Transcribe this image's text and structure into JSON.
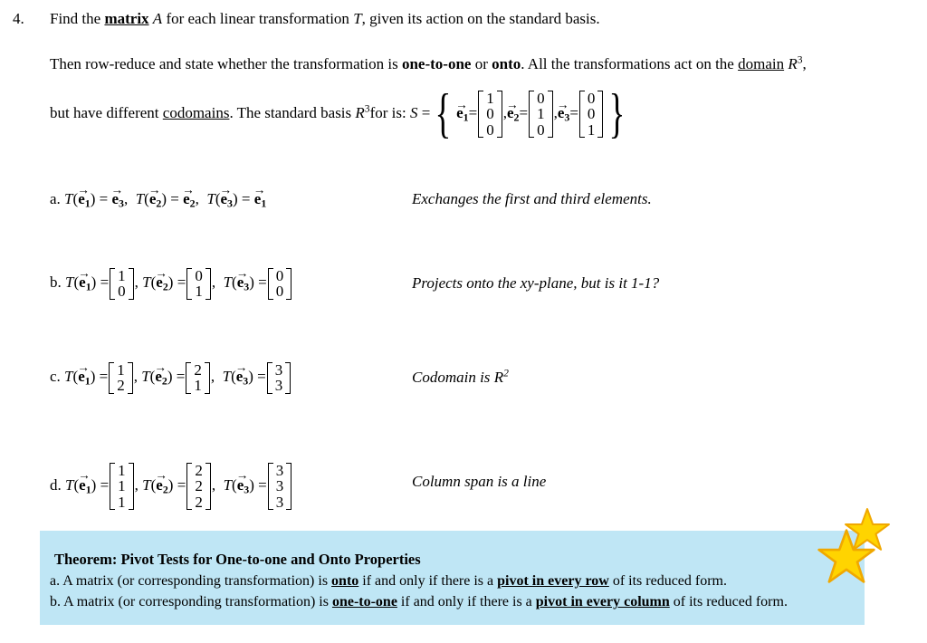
{
  "problem": {
    "number": "4.",
    "intro_1_pre": "Find the ",
    "intro_1_matrix": "matrix",
    "intro_1_A": "A",
    "intro_1_mid": " for each linear transformation ",
    "intro_1_T": "T",
    "intro_1_post": ", given its action on the standard basis.",
    "intro_2_pre": "Then row-reduce and state whether the transformation is ",
    "intro_2_onetoone": "one-to-one",
    "intro_2_or": " or ",
    "intro_2_onto": "onto",
    "intro_2_mid": ". All the transformations act on the ",
    "intro_2_domain": "domain",
    "intro_2_R": "R",
    "intro_2_R_exp": "3",
    "intro_2_end": ",",
    "intro_3_pre": "but have different ",
    "intro_3_codomains": "codomains",
    "intro_3_mid": ". The standard basis ",
    "intro_3_R": "R",
    "intro_3_R_exp": "3",
    "intro_3_for": "for is: ",
    "intro_3_S": "S",
    "intro_3_eq": " =",
    "brace_open": "{",
    "brace_close": "}",
    "basis": [
      {
        "name": "e",
        "sub": "1",
        "eq": "=",
        "entries": [
          "1",
          "0",
          "0"
        ],
        "sep": ","
      },
      {
        "name": "e",
        "sub": "2",
        "eq": "=",
        "entries": [
          "0",
          "1",
          "0"
        ],
        "sep": ","
      },
      {
        "name": "e",
        "sub": "3",
        "eq": "=",
        "entries": [
          "0",
          "0",
          "1"
        ],
        "sep": ""
      }
    ]
  },
  "items": [
    {
      "label": "a.",
      "kind": "vectors",
      "maps": [
        {
          "T": "T",
          "arg_sub": "1",
          "eq": "=",
          "result_kind": "basis",
          "result_sub": "3",
          "sep": ","
        },
        {
          "T": "T",
          "arg_sub": "2",
          "eq": "=",
          "result_kind": "basis",
          "result_sub": "2",
          "sep": ","
        },
        {
          "T": "T",
          "arg_sub": "3",
          "eq": "=",
          "result_kind": "basis",
          "result_sub": "1",
          "sep": ""
        }
      ],
      "description": "Exchanges the first and third elements."
    },
    {
      "label": "b.",
      "kind": "columns",
      "maps": [
        {
          "T": "T",
          "arg_sub": "1",
          "eq": "=",
          "result_kind": "column",
          "entries": [
            "1",
            "0"
          ],
          "sep": ","
        },
        {
          "T": "T",
          "arg_sub": "2",
          "eq": "=",
          "result_kind": "column",
          "entries": [
            "0",
            "1"
          ],
          "sep": ","
        },
        {
          "T": "T",
          "arg_sub": "3",
          "eq": "=",
          "result_kind": "column",
          "entries": [
            "0",
            "0"
          ],
          "sep": ""
        }
      ],
      "description": "Projects onto the xy-plane, but is it 1-1?"
    },
    {
      "label": "c.",
      "kind": "columns",
      "maps": [
        {
          "T": "T",
          "arg_sub": "1",
          "eq": "=",
          "result_kind": "column",
          "entries": [
            "1",
            "2"
          ],
          "sep": ","
        },
        {
          "T": "T",
          "arg_sub": "2",
          "eq": "=",
          "result_kind": "column",
          "entries": [
            "2",
            "1"
          ],
          "sep": ","
        },
        {
          "T": "T",
          "arg_sub": "3",
          "eq": "=",
          "result_kind": "column",
          "entries": [
            "3",
            "3"
          ],
          "sep": ""
        }
      ],
      "description_pre": "Codomain is ",
      "description_R": "R",
      "description_R_exp": "2"
    },
    {
      "label": "d.",
      "kind": "columns",
      "maps": [
        {
          "T": "T",
          "arg_sub": "1",
          "eq": "=",
          "result_kind": "column",
          "entries": [
            "1",
            "1",
            "1"
          ],
          "sep": ","
        },
        {
          "T": "T",
          "arg_sub": "2",
          "eq": "=",
          "result_kind": "column",
          "entries": [
            "2",
            "2",
            "2"
          ],
          "sep": ","
        },
        {
          "T": "T",
          "arg_sub": "3",
          "eq": "=",
          "result_kind": "column",
          "entries": [
            "3",
            "3",
            "3"
          ],
          "sep": ""
        }
      ],
      "description": "Column span is a line"
    }
  ],
  "theorem": {
    "title": "Theorem: Pivot Tests for One-to-one and Onto Properties",
    "line_a_pre": "a. A matrix (or corresponding transformation) is ",
    "line_a_term": "onto",
    "line_a_mid": " if and only if there is a ",
    "line_a_term2": "pivot in every row",
    "line_a_post": " of its reduced form.",
    "line_b_pre": "b. A matrix (or corresponding transformation) is ",
    "line_b_term": "one-to-one",
    "line_b_mid": " if and only if there is a ",
    "line_b_term2": "pivot in every column",
    "line_b_post": " of its reduced form.",
    "background_color": "#bfe6f5"
  },
  "decorations": {
    "star_fill": "#ffd700",
    "star_stroke": "#f5a623",
    "star_big_name": "gold-star-large",
    "star_small_name": "gold-star-small"
  }
}
